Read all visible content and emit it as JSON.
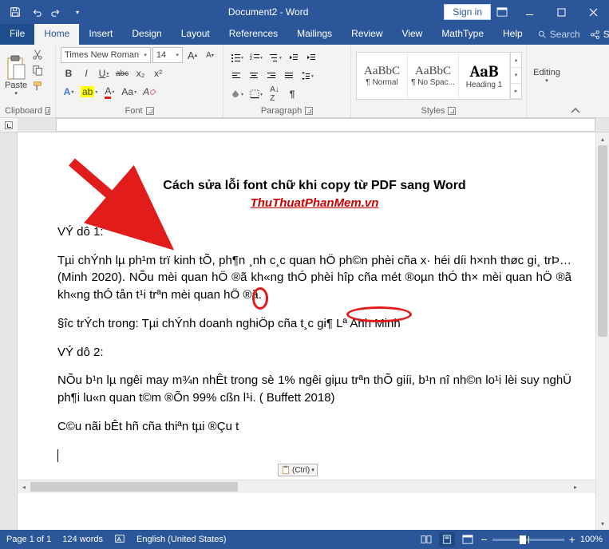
{
  "titlebar": {
    "title": "Document2 - Word",
    "signin": "Sign in"
  },
  "tabs": {
    "file": "File",
    "home": "Home",
    "insert": "Insert",
    "design": "Design",
    "layout": "Layout",
    "references": "References",
    "mailings": "Mailings",
    "review": "Review",
    "view": "View",
    "mathtype": "MathType",
    "help": "Help",
    "tellme": "Search",
    "share": "Share"
  },
  "ribbon": {
    "clipboard": {
      "paste": "Paste",
      "label": "Clipboard"
    },
    "font": {
      "name": "Times New Roman",
      "size": "14",
      "bold": "B",
      "italic": "I",
      "underline": "U",
      "strike": "abc",
      "sub": "x₂",
      "sup": "x²",
      "grow": "A",
      "shrink": "A",
      "changecase": "Aa",
      "clear": "A",
      "label": "Font"
    },
    "paragraph": {
      "label": "Paragraph"
    },
    "styles": {
      "label": "Styles",
      "s1": {
        "preview": "AaBbC",
        "name": "¶ Normal"
      },
      "s2": {
        "preview": "AaBbC",
        "name": "¶ No Spac..."
      },
      "s3": {
        "preview": "AaB",
        "name": "Heading 1"
      }
    },
    "editing": {
      "label": "Editing"
    }
  },
  "document": {
    "title": "Cách sửa lỗi font chữ khi copy từ PDF sang Word",
    "subtitle": "ThuThuatPhanMem.vn",
    "p1": "VÝ dô 1:",
    "p2": "Tµi chÝnh lµ ph¹m trï kinh tÕ, ph¶n ¸nh c¸c quan hÖ ph©n phèi cña x· héi d­íi h×nh thøc gi¸ trÞ… (Minh 2020). NÕu mèi quan hÖ ®ã kh«ng thÓ phèi hîp cña mét ®oµn thÓ th× mèi quan hÖ ®ã kh«ng thÓ tån t¹i trªn mèi quan hÖ ®ã.",
    "p3": "§­îc trÝch trong: Tµi chÝnh doanh nghiÖp cña t¸c gi¶ Lª Anh Minh",
    "p4": "VÝ dô 2:",
    "p5": "NÕu b¹n lµ ng­êi may m¾n nhÊt trong sè 1% ng­êi giµu trªn thÕ giíi, b¹n nî nh©n lo¹i lèi suy nghÜ ph¶i lu«n quan t©m ®Õn 99% cßn l¹i. ( Buffett 2018)",
    "p6": "C©u nãi bÊt hñ cña thiªn tµi ®Çu t­",
    "pasteopt": "(Ctrl)"
  },
  "status": {
    "page": "Page 1 of 1",
    "words": "124 words",
    "lang": "English (United States)",
    "zoom": "100%"
  }
}
